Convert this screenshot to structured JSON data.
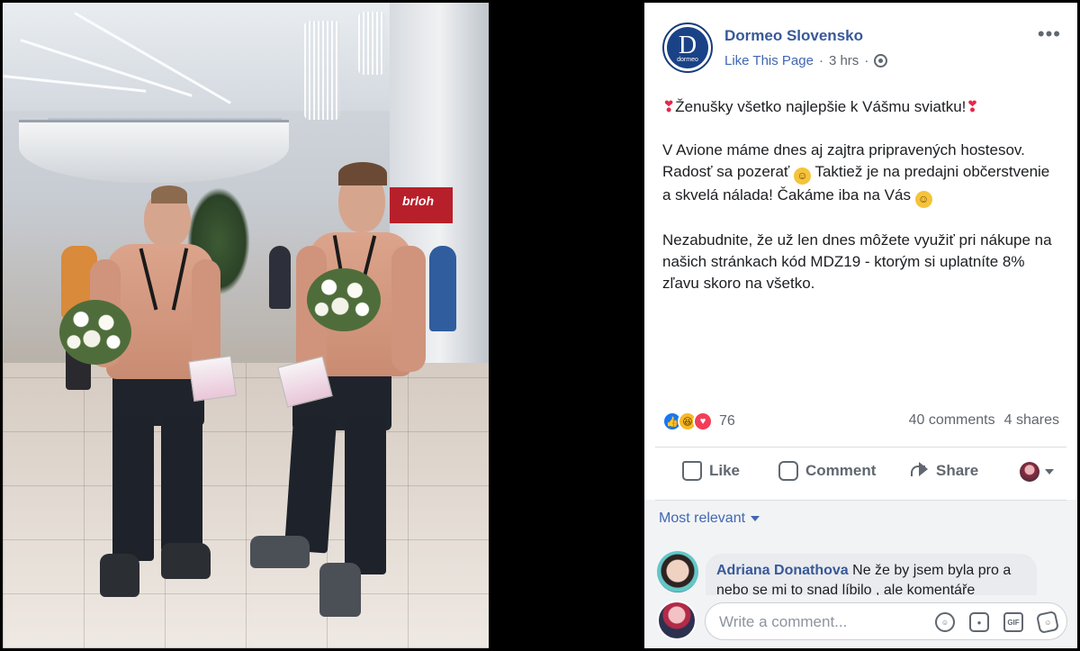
{
  "photo": {
    "store_sign": "brloh"
  },
  "post": {
    "page_name": "Dormeo Slovensko",
    "avatar_letter": "D",
    "avatar_brand": "dormeo",
    "like_page": "Like This Page",
    "separator": "·",
    "time": "3 hrs",
    "separator2": "·",
    "line1_pre": "❣",
    "line1": "Ženušky všetko najlepšie k Vášmu sviatku!",
    "line1_post": "❣",
    "para2_a": "V Avione máme dnes aj zajtra pripravených hostesov. Radosť sa pozerať",
    "para2_b": "Taktiež je na predajni občerstvenie a skvelá nálada! Čakáme iba na Vás",
    "para3": "Nezabudnite, že už len dnes môžete využiť pri nákupe na našich stránkach kód MDZ19 - ktorým si uplatníte 8% zľavu skoro na všetko.",
    "reaction_count": "76",
    "comments": "40 comments",
    "shares": "4 shares"
  },
  "actions": {
    "like": "Like",
    "comment": "Comment",
    "share": "Share"
  },
  "comments": {
    "sort_label": "Most relevant",
    "first": {
      "author": "Adriana Donathova",
      "text": "Ne že by jsem byla pro a nebo se mi to snad líbilo , ale komentáře"
    },
    "composer_placeholder": "Write a comment...",
    "icons": [
      "emoji-icon",
      "camera-icon",
      "gif-icon",
      "sticker-icon"
    ],
    "gif_label": "GIF"
  },
  "colors": {
    "brand_blue": "#385898",
    "link_blue": "#4267b2",
    "like_blue": "#1877f2",
    "love_red": "#f33e58",
    "haha_yellow": "#f7b928"
  }
}
